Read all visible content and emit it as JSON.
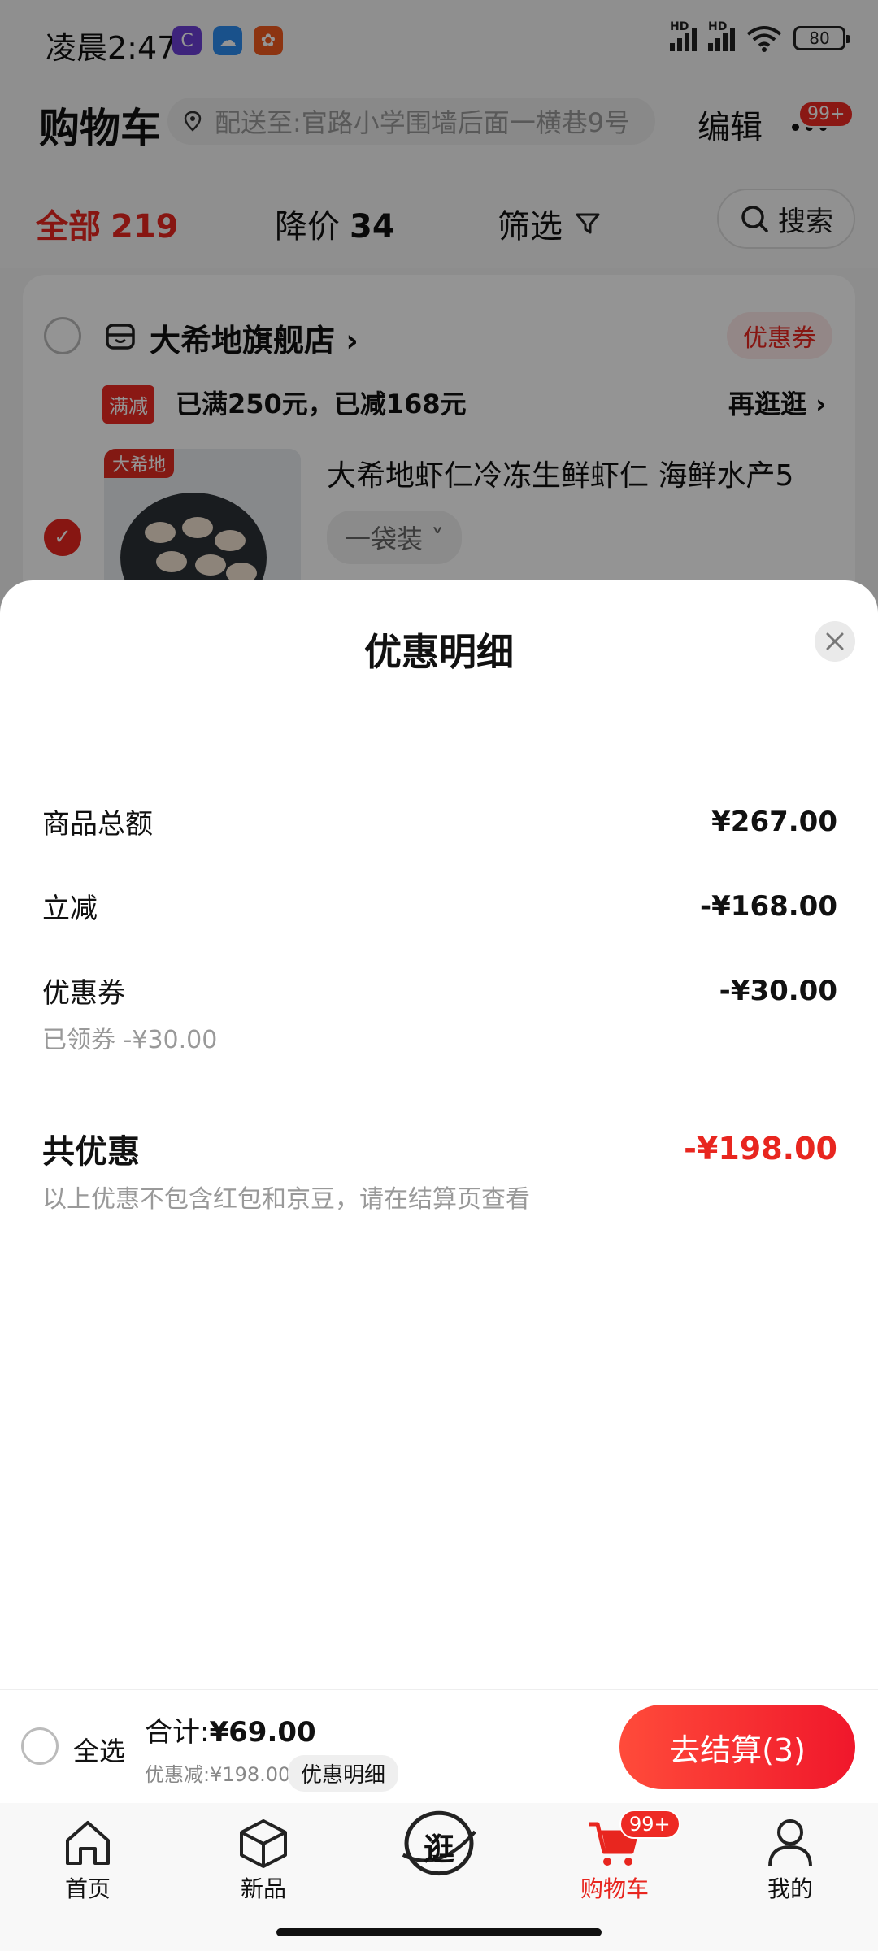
{
  "status_bar": {
    "time": "凌晨2:47",
    "battery": "80",
    "hd1": "HD",
    "hd2": "HD"
  },
  "header": {
    "title": "购物车",
    "address": "配送至:官路小学围墙后面一横巷9号",
    "edit_label": "编辑",
    "more_badge": "99+"
  },
  "filters": {
    "all_label": "全部",
    "all_count": "219",
    "price_drop_label": "降价",
    "price_drop_count": "34",
    "screen_label": "筛选",
    "search_label": "搜索"
  },
  "store": {
    "name": "大希地旗舰店 ›",
    "coupon_label": "优惠券",
    "promo_tag": "满减",
    "promo_text": "已满250元，已减168元",
    "browse_label": "再逛逛 ›"
  },
  "product": {
    "brand": "大希地",
    "title": "大希地虾仁冷冻生鲜虾仁 海鲜水产5",
    "spec": "一袋装 ˅"
  },
  "sheet": {
    "title": "优惠明细",
    "rows": [
      {
        "label": "商品总额",
        "value": "¥267.00"
      },
      {
        "label": "立减",
        "value": "-¥168.00"
      },
      {
        "label": "优惠券",
        "value": "-¥30.00",
        "sub": "已领券 -¥30.00"
      }
    ],
    "total_label": "共优惠",
    "total_value": "-¥198.00",
    "note": "以上优惠不包含红包和京豆，请在结算页查看"
  },
  "checkout": {
    "select_all": "全选",
    "sum_label": "合计:",
    "sum_value": "¥69.00",
    "discount_text": "优惠减:¥198.00",
    "detail_label": "优惠明细",
    "button_label": "去结算(3)"
  },
  "tabbar": {
    "items": [
      {
        "label": "首页",
        "icon": "home-icon"
      },
      {
        "label": "新品",
        "icon": "cube-icon"
      },
      {
        "label": "逛",
        "icon": "browse-icon"
      },
      {
        "label": "购物车",
        "icon": "cart-icon",
        "badge": "99+"
      },
      {
        "label": "我的",
        "icon": "person-icon"
      }
    ]
  },
  "colors": {
    "accent": "#e8261f",
    "overlay": "rgba(0,0,0,0.42)"
  }
}
